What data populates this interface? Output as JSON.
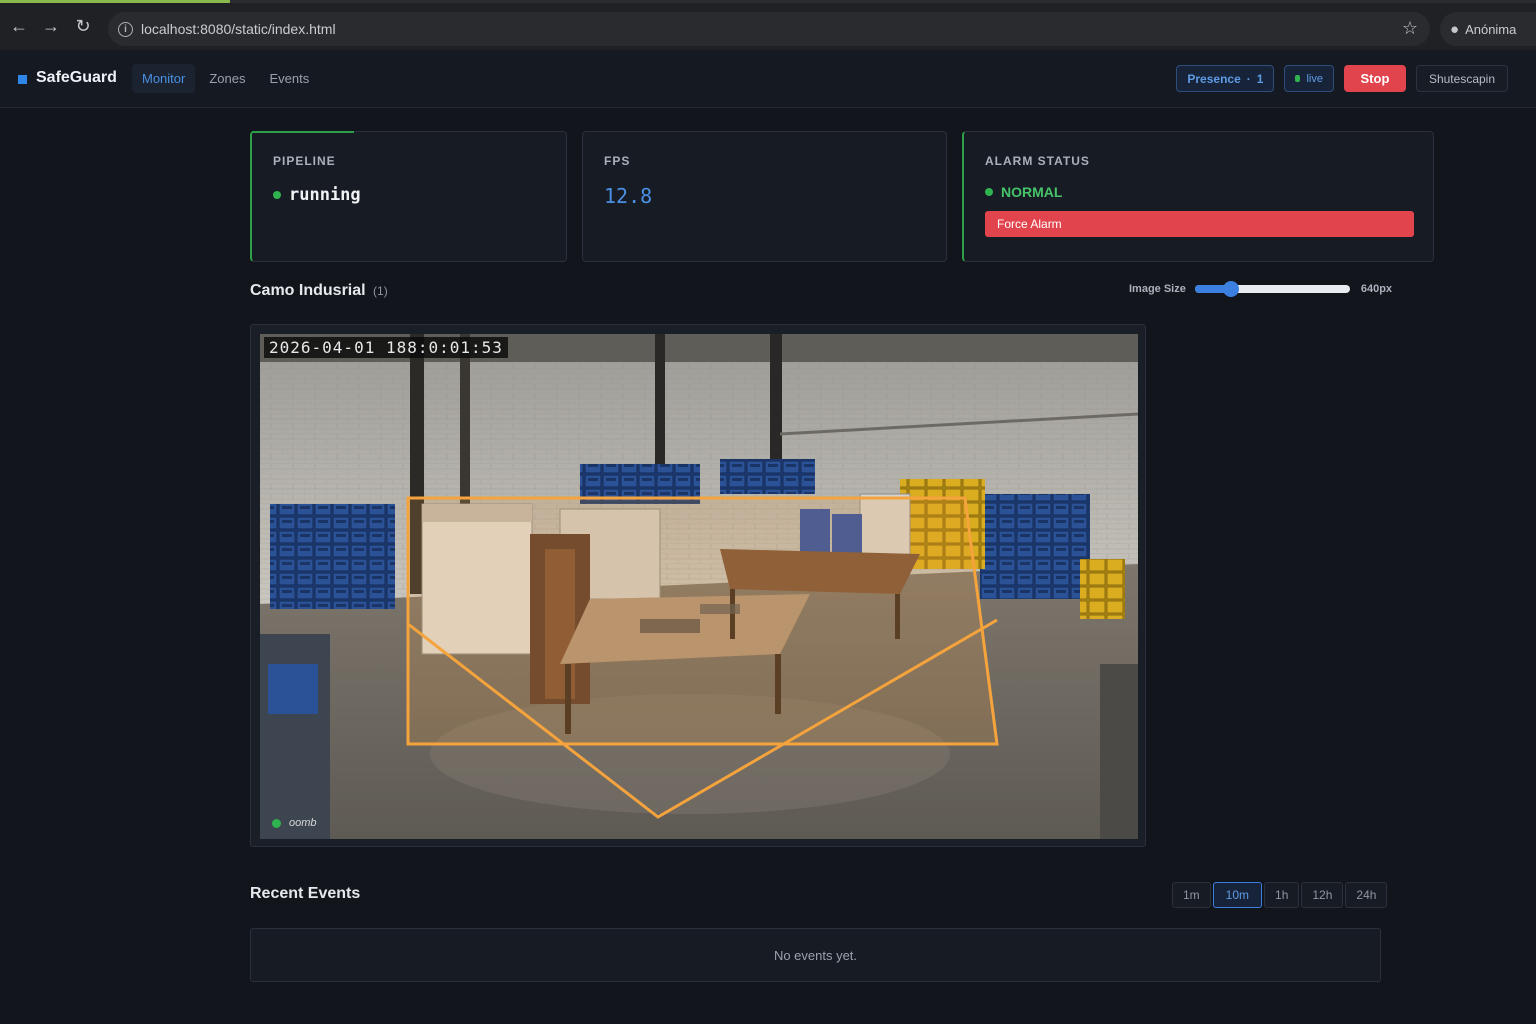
{
  "browser": {
    "url": "localhost:8080/static/index.html",
    "profile_label": "Anónima"
  },
  "app": {
    "brand": "SafeGuard",
    "nav": [
      {
        "label": "Monitor",
        "active": true
      },
      {
        "label": "Zones",
        "active": false
      },
      {
        "label": "Events",
        "active": false
      }
    ],
    "presence_label": "Presence",
    "presence_count": "1",
    "live_label": "live",
    "stop_label": "Stop",
    "snapshot_label": "Shutescapin"
  },
  "cards": {
    "pipeline": {
      "label": "PIPELINE",
      "value": "running"
    },
    "fps": {
      "label": "FPS",
      "value": "12.8"
    },
    "alarm": {
      "label": "ALARM STATUS",
      "value": "NORMAL",
      "button": "Force Alarm"
    }
  },
  "camera": {
    "title": "Camo Indusrial",
    "id": "(1)",
    "size_label": "Image Size",
    "size_value": "640px",
    "size_fraction": 0.23,
    "timestamp": "2026-04-01 188:0:01:53",
    "status_text": "oomb",
    "zone_color": "#f5a33c"
  },
  "events": {
    "title": "Recent Events",
    "ranges": [
      {
        "label": "1m",
        "active": false
      },
      {
        "label": "10m",
        "active": true
      },
      {
        "label": "1h",
        "active": false
      },
      {
        "label": "12h",
        "active": false
      },
      {
        "label": "24h",
        "active": false
      }
    ],
    "empty_text": "No events yet."
  }
}
